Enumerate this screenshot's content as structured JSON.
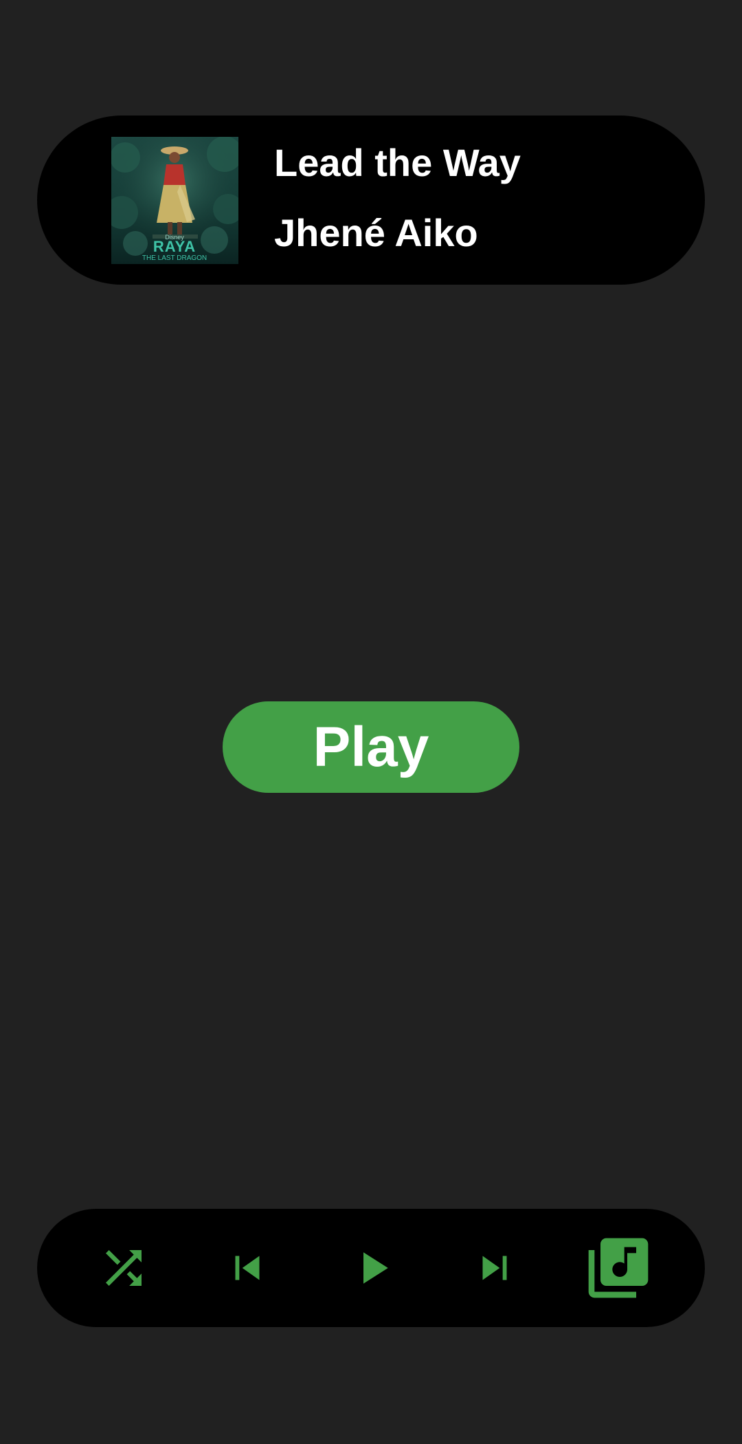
{
  "now_playing": {
    "title": "Lead the Way",
    "artist": "Jhené Aiko",
    "album_art": {
      "label_top": "Disney",
      "label_main": "RAYA",
      "label_sub": "THE LAST DRAGON"
    }
  },
  "main": {
    "play_label": "Play"
  },
  "controls": {
    "icons": [
      "shuffle-icon",
      "skip-previous-icon",
      "play-icon",
      "skip-next-icon",
      "library-music-icon"
    ]
  },
  "colors": {
    "background": "#212121",
    "card": "#000000",
    "accent": "#43a047",
    "text": "#ffffff"
  }
}
